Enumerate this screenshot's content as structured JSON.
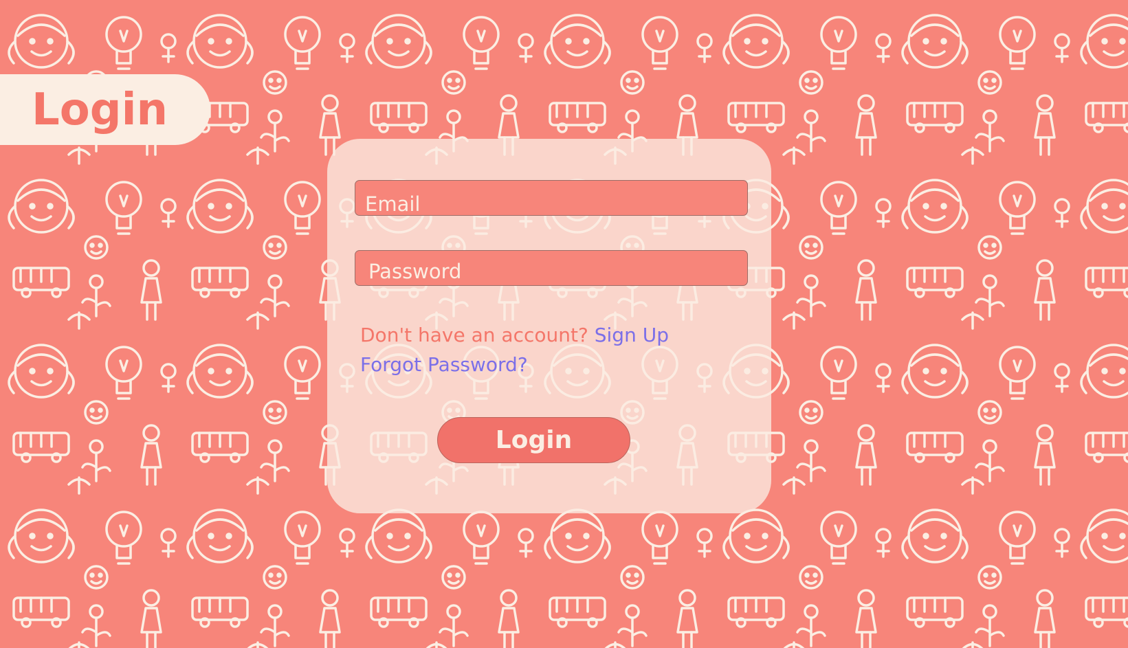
{
  "page": {
    "title": "Login",
    "colors": {
      "background": "#f7857a",
      "cream": "#fbeee3",
      "accent_text": "#f47669",
      "link": "#7b6fe8"
    }
  },
  "form": {
    "email_placeholder": "Email",
    "password_placeholder": "Password",
    "no_account_text": "Don't have an account",
    "question_mark": "?",
    "signup_label": "Sign Up",
    "forgot_label": "Forgot Password?",
    "login_label": "Login"
  },
  "background": {
    "pattern": "doodle-icons"
  }
}
